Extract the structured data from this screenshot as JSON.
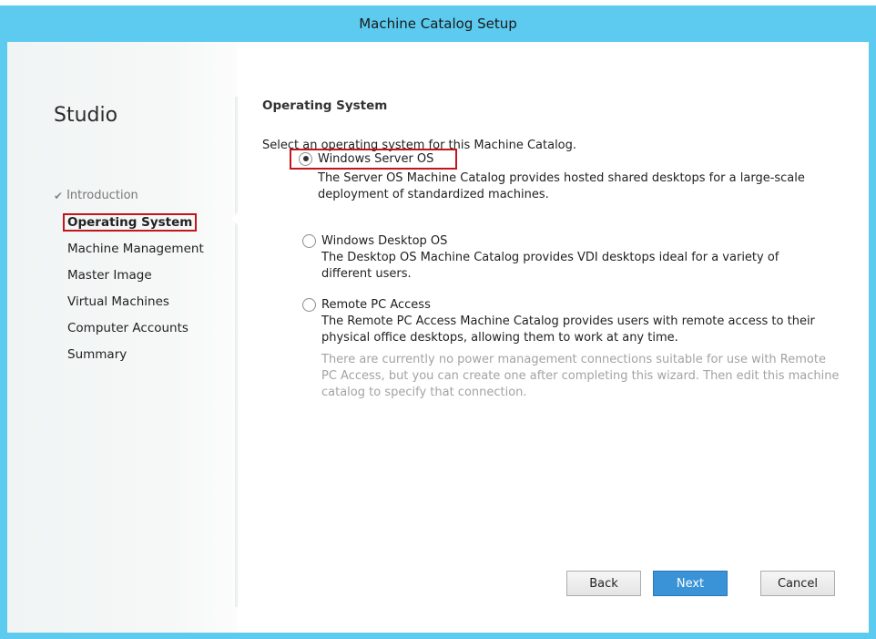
{
  "window": {
    "title": "Machine Catalog Setup"
  },
  "sidebar": {
    "brand": "Studio",
    "steps": [
      {
        "label": "Introduction",
        "state": "done"
      },
      {
        "label": "Operating System",
        "state": "current"
      },
      {
        "label": "Machine Management",
        "state": "pending"
      },
      {
        "label": "Master Image",
        "state": "pending"
      },
      {
        "label": "Virtual Machines",
        "state": "pending"
      },
      {
        "label": "Computer Accounts",
        "state": "pending"
      },
      {
        "label": "Summary",
        "state": "pending"
      }
    ]
  },
  "main": {
    "heading": "Operating System",
    "prompt": "Select an operating system for this Machine Catalog.",
    "options": [
      {
        "label": "Windows Server OS",
        "selected": true,
        "description": "The Server OS Machine Catalog provides hosted shared desktops for a large-scale deployment of standardized machines."
      },
      {
        "label": "Windows Desktop OS",
        "selected": false,
        "description": "The Desktop OS Machine Catalog provides VDI desktops ideal for a variety of different users."
      },
      {
        "label": "Remote PC Access",
        "selected": false,
        "description": "The Remote PC Access Machine Catalog provides users with remote access to their physical office desktops, allowing them to work at any time."
      }
    ],
    "note": "There are currently no power management connections suitable for use with Remote PC Access, but you can create one after completing this wizard. Then edit this machine catalog to specify that connection."
  },
  "buttons": {
    "back": "Back",
    "next": "Next",
    "cancel": "Cancel"
  },
  "colors": {
    "title_bar": "#5ccbef",
    "accent_button": "#3a93d6",
    "highlight_box": "#c4151c"
  }
}
